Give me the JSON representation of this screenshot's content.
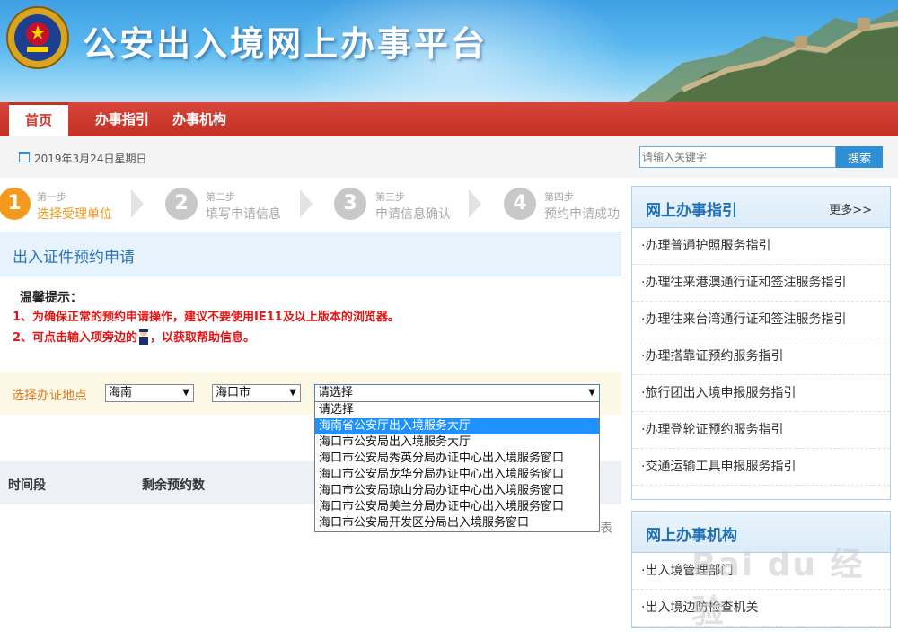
{
  "header": {
    "site_title": "公安出入境网上办事平台"
  },
  "nav": {
    "items": [
      {
        "label": "首页",
        "active": true
      },
      {
        "label": "办事指引",
        "active": false
      },
      {
        "label": "办事机构",
        "active": false
      }
    ]
  },
  "datebar": {
    "date_text": "2019年3月24日星期日",
    "search_placeholder": "请输入关键字",
    "search_button": "搜索"
  },
  "steps": [
    {
      "number": "1",
      "small": "第一步",
      "label": "选择受理单位",
      "state": "current"
    },
    {
      "number": "2",
      "small": "第二步",
      "label": "填写申请信息",
      "state": "pending"
    },
    {
      "number": "3",
      "small": "第三步",
      "label": "申请信息确认",
      "state": "pending"
    },
    {
      "number": "4",
      "small": "第四步",
      "label": "预约申请成功",
      "state": "pending"
    }
  ],
  "main": {
    "section_title": "出入证件预约申请",
    "tip_title": "温馨提示：",
    "tip_1": "1、为确保正常的预约申请操作，建议不要使用IE11及以上版本的浏览器。",
    "tip_2_before": "2、可点击输入项旁边的",
    "tip_2_after": "，以获取帮助信息。",
    "location_label": "选择办证地点",
    "province_value": "海南",
    "city_value": "海口市",
    "office_value": "请选择",
    "office_options": [
      "请选择",
      "海南省公安厅出入境服务大厅",
      "海口市公安局出入境服务大厅",
      "海口市公安局秀英分局办证中心出入境服务窗口",
      "海口市公安局龙华分局办证中心出入境服务窗口",
      "海口市公安局琼山分局办证中心出入境服务窗口",
      "海口市公安局美兰分局办证中心出入境服务窗口",
      "海口市公安局开发区分局出入境服务窗口"
    ],
    "highlighted_option_index": 1,
    "table_col_1": "时间段",
    "table_col_2": "剩余预约数",
    "partial_text": "表"
  },
  "sidebar": {
    "guide_title": "网上办事指引",
    "guide_more": "更多>>",
    "guide_items": [
      "·办理普通护照服务指引",
      "·办理往来港澳通行证和签注服务指引",
      "·办理往来台湾通行证和签注服务指引",
      "·办理搭靠证预约服务指引",
      "·旅行团出入境申报服务指引",
      "·办理登轮证预约服务指引",
      "·交通运输工具申报服务指引"
    ],
    "org_title": "网上办事机构",
    "org_items": [
      "·出入境管理部门",
      "·出入境边防检查机关"
    ]
  },
  "watermark": "Bai du 经验",
  "colors": {
    "nav_red": "#c23026",
    "accent_blue": "#2e8fd6",
    "step_active": "#f39a1e",
    "step_inactive": "#c8c8c8",
    "warning_red": "#e21515"
  }
}
